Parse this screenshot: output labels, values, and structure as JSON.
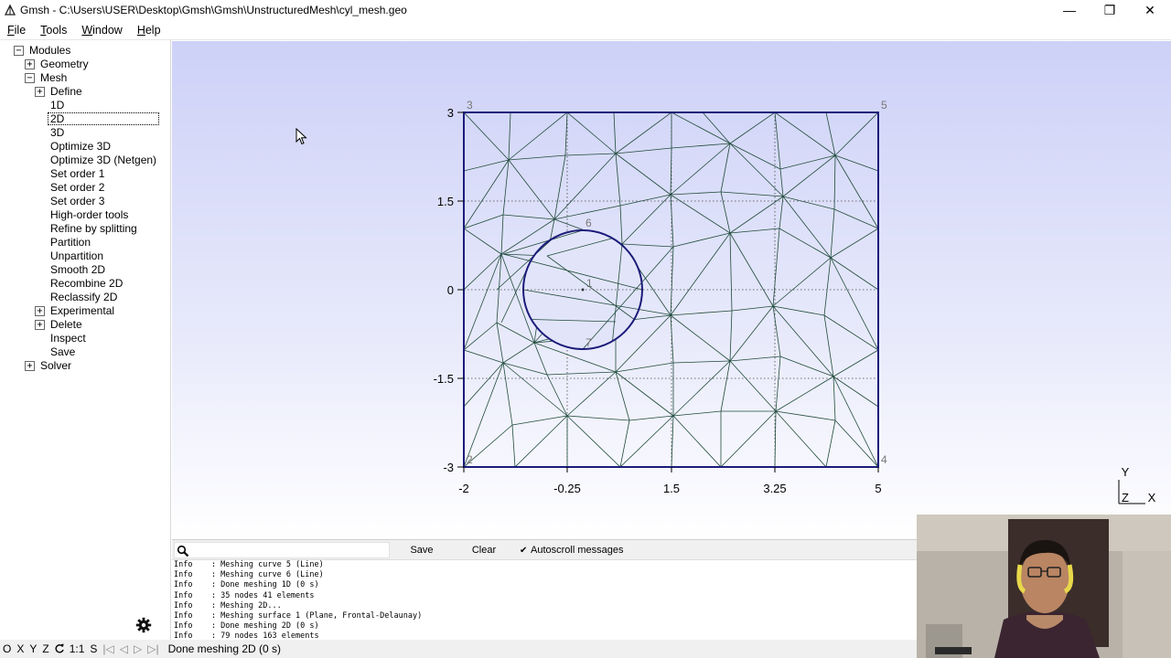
{
  "window": {
    "title": "Gmsh - C:\\Users\\USER\\Desktop\\Gmsh\\Gmsh\\UnstructuredMesh\\cyl_mesh.geo",
    "minimize": "—",
    "restore": "❐",
    "close": "✕"
  },
  "menu": [
    {
      "label": "File",
      "key": "F",
      "rest": "ile"
    },
    {
      "label": "Tools",
      "key": "T",
      "rest": "ools"
    },
    {
      "label": "Window",
      "key": "W",
      "rest": "indow"
    },
    {
      "label": "Help",
      "key": "H",
      "rest": "elp"
    }
  ],
  "tree": [
    {
      "label": "Modules",
      "box": "−"
    },
    {
      "label": "Geometry",
      "box": "+"
    },
    {
      "label": "Mesh",
      "box": "−"
    },
    {
      "label": "Define",
      "box": "+"
    },
    {
      "label": "1D"
    },
    {
      "label": "2D",
      "selected": true
    },
    {
      "label": "3D"
    },
    {
      "label": "Optimize 3D"
    },
    {
      "label": "Optimize 3D (Netgen)"
    },
    {
      "label": "Set order 1"
    },
    {
      "label": "Set order 2"
    },
    {
      "label": "Set order 3"
    },
    {
      "label": "High-order tools"
    },
    {
      "label": "Refine by splitting"
    },
    {
      "label": "Partition"
    },
    {
      "label": "Unpartition"
    },
    {
      "label": "Smooth 2D"
    },
    {
      "label": "Recombine 2D"
    },
    {
      "label": "Reclassify 2D"
    },
    {
      "label": "Experimental",
      "box": "+"
    },
    {
      "label": "Delete",
      "box": "+"
    },
    {
      "label": "Inspect"
    },
    {
      "label": "Save"
    },
    {
      "label": "Solver",
      "box": "+"
    }
  ],
  "graphics": {
    "x_ticks": [
      "-2",
      "-0.25",
      "1.5",
      "3.25",
      "5"
    ],
    "y_ticks": [
      "3",
      "1.5",
      "0",
      "-1.5",
      "-3"
    ],
    "point_labels": [
      "3",
      "5",
      "6",
      "1",
      "7",
      "2",
      "4"
    ],
    "axes_labels": {
      "y": "Y",
      "z": "Z",
      "x": "X"
    }
  },
  "messages": {
    "search_placeholder": "",
    "save_label": "Save",
    "clear_label": "Clear",
    "autoscroll_label": "Autoscroll messages",
    "autoscroll_checked": true,
    "lines": [
      "Info    : Meshing curve 5 (Line)",
      "Info    : Meshing curve 6 (Line)",
      "Info    : Done meshing 1D (0 s)",
      "Info    : 35 nodes 41 elements",
      "Info    : Meshing 2D...",
      "Info    : Meshing surface 1 (Plane, Frontal-Delaunay)",
      "Info    : Done meshing 2D (0 s)",
      "Info    : 79 nodes 163 elements"
    ]
  },
  "status": {
    "o": "O",
    "x": "X",
    "y": "Y",
    "z": "Z",
    "scale": "1:1",
    "s": "S",
    "message": "Done meshing 2D (0 s)"
  },
  "colors": {
    "background_top": "#cdd1f7",
    "mesh_line": "#1f4a3a",
    "boundary": "#1c1c7a",
    "grid": "#444444"
  }
}
